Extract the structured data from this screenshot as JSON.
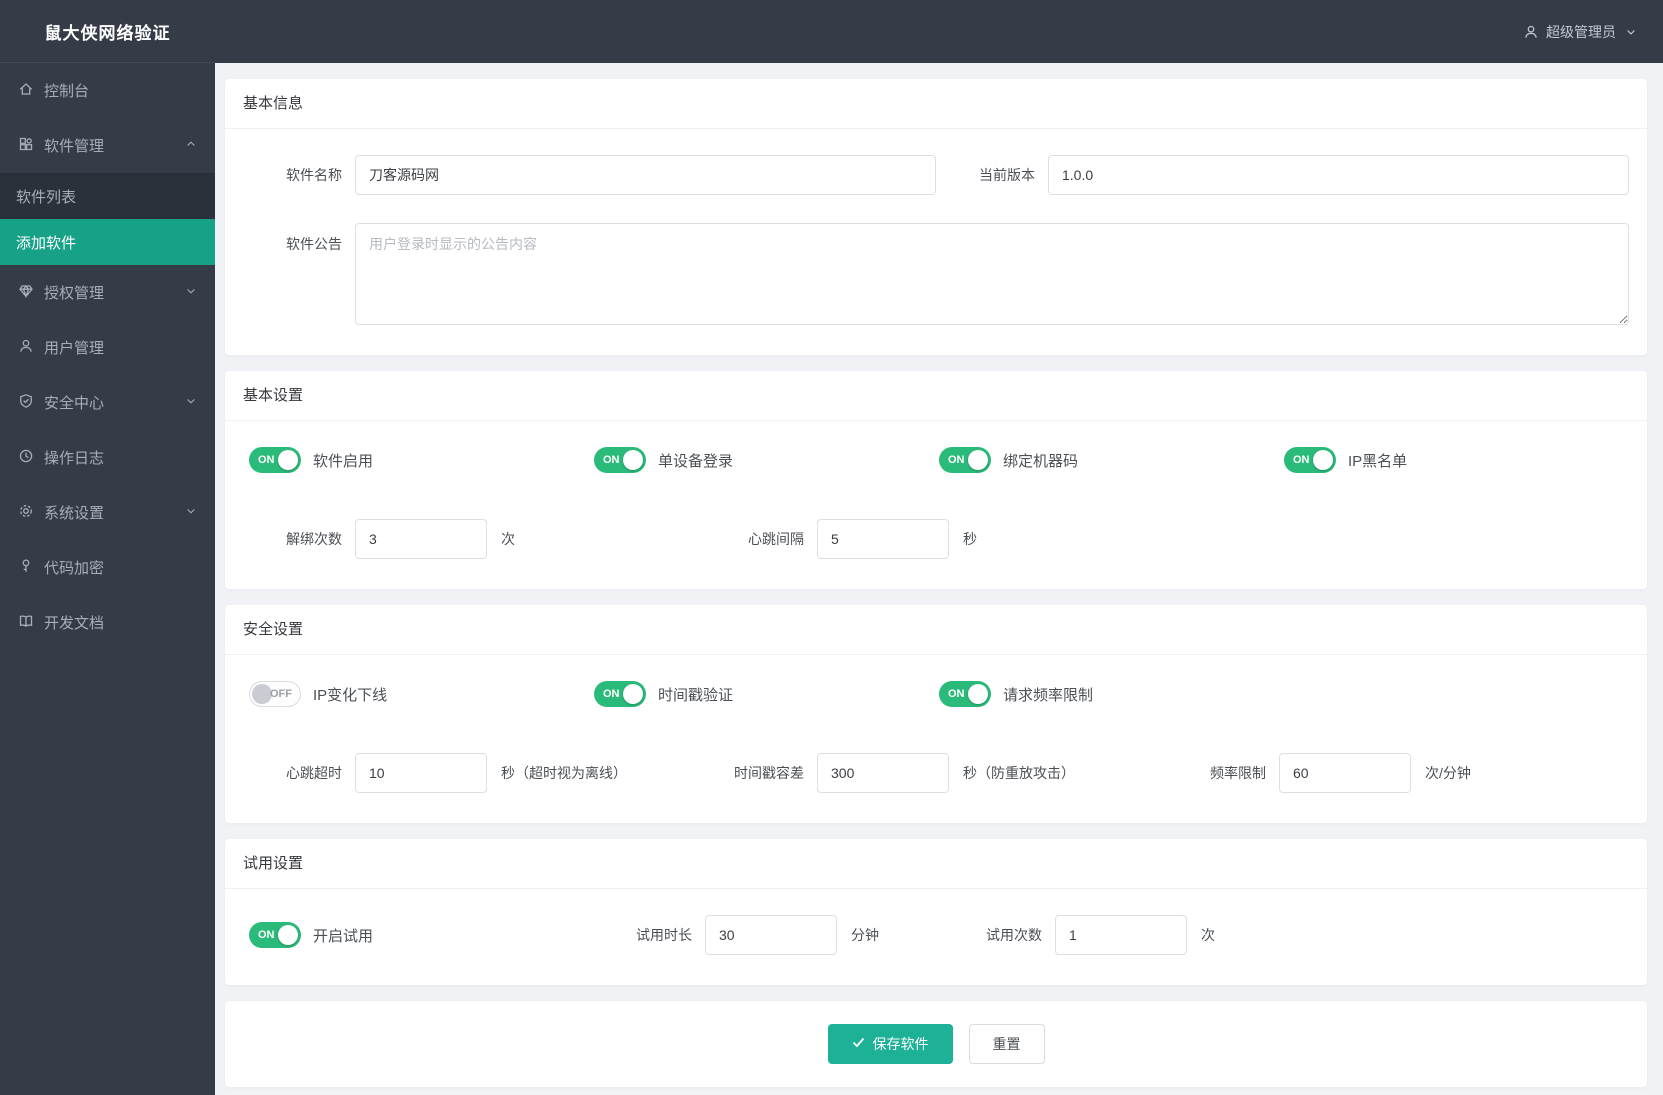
{
  "app": {
    "title": "鼠大侠网络验证"
  },
  "topbar": {
    "user_label": "超级管理员"
  },
  "sidebar": {
    "items": [
      {
        "label": "控制台"
      },
      {
        "label": "软件管理"
      },
      {
        "label": "软件列表"
      },
      {
        "label": "添加软件"
      },
      {
        "label": "授权管理"
      },
      {
        "label": "用户管理"
      },
      {
        "label": "安全中心"
      },
      {
        "label": "操作日志"
      },
      {
        "label": "系统设置"
      },
      {
        "label": "代码加密"
      },
      {
        "label": "开发文档"
      }
    ]
  },
  "basic_info": {
    "title": "基本信息",
    "name_label": "软件名称",
    "name_value": "刀客源码网",
    "version_label": "当前版本",
    "version_value": "1.0.0",
    "notice_label": "软件公告",
    "notice_placeholder": "用户登录时显示的公告内容"
  },
  "basic_settings": {
    "title": "基本设置",
    "toggles": [
      {
        "label": "软件启用",
        "state": "ON"
      },
      {
        "label": "单设备登录",
        "state": "ON"
      },
      {
        "label": "绑定机器码",
        "state": "ON"
      },
      {
        "label": "IP黑名单",
        "state": "ON"
      }
    ],
    "fields": [
      {
        "label": "解绑次数",
        "value": "3",
        "suffix": "次"
      },
      {
        "label": "心跳间隔",
        "value": "5",
        "suffix": "秒"
      }
    ]
  },
  "security_settings": {
    "title": "安全设置",
    "toggles": [
      {
        "label": "IP变化下线",
        "state": "OFF"
      },
      {
        "label": "时间戳验证",
        "state": "ON"
      },
      {
        "label": "请求频率限制",
        "state": "ON"
      }
    ],
    "fields": [
      {
        "label": "心跳超时",
        "value": "10",
        "suffix": "秒（超时视为离线）"
      },
      {
        "label": "时间戳容差",
        "value": "300",
        "suffix": "秒（防重放攻击）"
      },
      {
        "label": "频率限制",
        "value": "60",
        "suffix": "次/分钟"
      }
    ]
  },
  "trial_settings": {
    "title": "试用设置",
    "toggle": {
      "label": "开启试用",
      "state": "ON"
    },
    "fields": [
      {
        "label": "试用时长",
        "value": "30",
        "suffix": "分钟"
      },
      {
        "label": "试用次数",
        "value": "1",
        "suffix": "次"
      }
    ]
  },
  "actions": {
    "save_label": "保存软件",
    "reset_label": "重置"
  },
  "colors": {
    "accent_teal": "#17a287",
    "save_button_teal": "#1db298",
    "toggle_green": "#2aba7a",
    "sidebar_bg": "#353c48",
    "content_bg": "#f0f2f5"
  }
}
